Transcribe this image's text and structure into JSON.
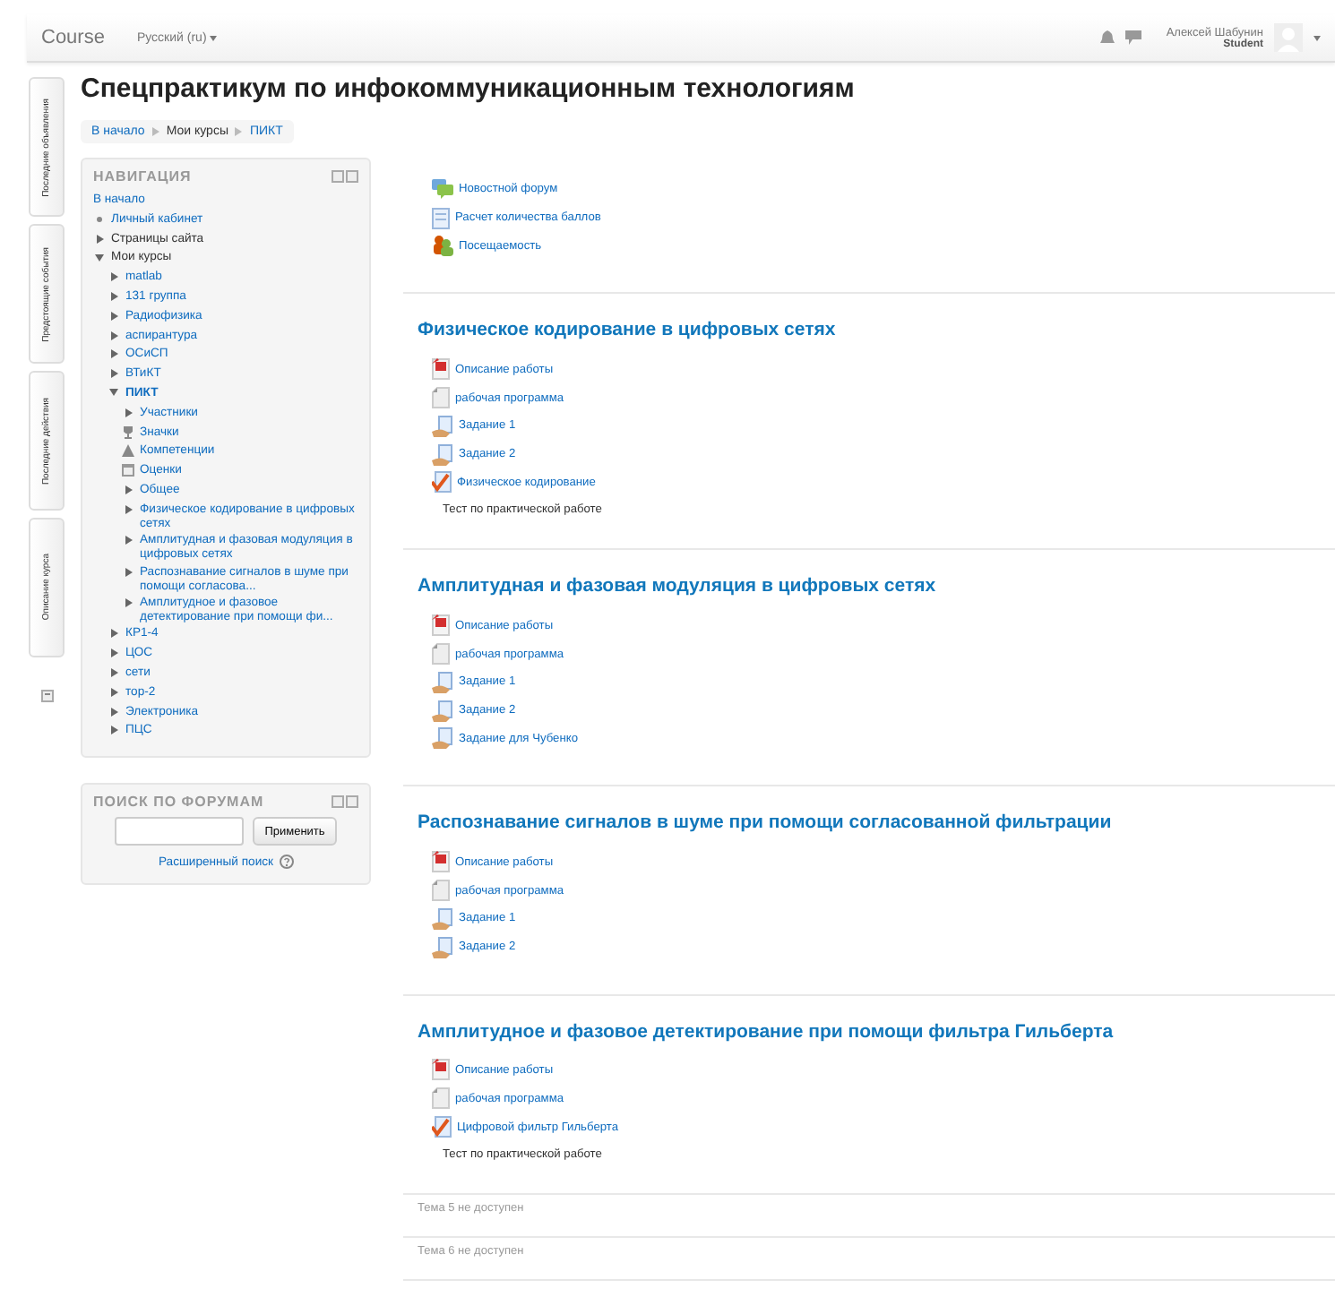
{
  "header": {
    "brand": "Course",
    "language": "Русский (ru)",
    "user_name": "Алексей Шабунин",
    "user_role": "Student"
  },
  "side_tabs": [
    "Последние объявления",
    "Предстоящие события",
    "Последние действия",
    "Описание курса"
  ],
  "page_title": "Спецпрактикум по инфокоммуникационным технологиям",
  "breadcrumb": [
    {
      "label": "В начало",
      "link": true
    },
    {
      "label": "Мои курсы",
      "link": false
    },
    {
      "label": "ПИКТ",
      "link": true
    }
  ],
  "navigation": {
    "title": "НАВИГАЦИЯ",
    "items": [
      {
        "label": "В начало",
        "kind": "plain",
        "link": true,
        "current": false
      },
      {
        "label": "Личный кабинет",
        "kind": "bullet",
        "link": true,
        "current": false
      },
      {
        "label": "Страницы сайта",
        "kind": "collapsed",
        "link": false,
        "current": false
      },
      {
        "label": "Мои курсы",
        "kind": "expanded",
        "link": false,
        "current": false,
        "children": [
          {
            "label": "matlab",
            "kind": "collapsed",
            "link": true,
            "current": false
          },
          {
            "label": "131 группа",
            "kind": "collapsed",
            "link": true,
            "current": false
          },
          {
            "label": "Радиофизика",
            "kind": "collapsed",
            "link": true,
            "current": false
          },
          {
            "label": "аспирантура",
            "kind": "collapsed",
            "link": true,
            "current": false
          },
          {
            "label": "ОСиСП",
            "kind": "collapsed",
            "link": true,
            "current": false
          },
          {
            "label": "ВТиКТ",
            "kind": "collapsed",
            "link": true,
            "current": false
          },
          {
            "label": "ПИКТ",
            "kind": "expanded",
            "link": true,
            "current": true,
            "children": [
              {
                "label": "Участники",
                "kind": "collapsed",
                "link": true,
                "current": false
              },
              {
                "label": "Значки",
                "kind": "trophy",
                "link": true,
                "current": false
              },
              {
                "label": "Компетенции",
                "kind": "competency",
                "link": true,
                "current": false
              },
              {
                "label": "Оценки",
                "kind": "grades",
                "link": true,
                "current": false
              },
              {
                "label": "Общее",
                "kind": "collapsed",
                "link": true,
                "current": false
              },
              {
                "label": "Физическое кодирование в цифровых сетях",
                "kind": "collapsed",
                "link": true,
                "current": false
              },
              {
                "label": "Амплитудная и фазовая модуляция в цифровых сетях",
                "kind": "collapsed",
                "link": true,
                "current": false
              },
              {
                "label": "Распознавание сигналов в шуме при помощи согласова...",
                "kind": "collapsed",
                "link": true,
                "current": false
              },
              {
                "label": "Амплитудное и фазовое детектирование при помощи фи...",
                "kind": "collapsed",
                "link": true,
                "current": false
              }
            ]
          },
          {
            "label": "КР1-4",
            "kind": "collapsed",
            "link": true,
            "current": false
          },
          {
            "label": "ЦОС",
            "kind": "collapsed",
            "link": true,
            "current": false
          },
          {
            "label": "сети",
            "kind": "collapsed",
            "link": true,
            "current": false
          },
          {
            "label": "тор-2",
            "kind": "collapsed",
            "link": true,
            "current": false
          },
          {
            "label": "Электроника",
            "kind": "collapsed",
            "link": true,
            "current": false
          },
          {
            "label": "ПЦС",
            "kind": "collapsed",
            "link": true,
            "current": false
          }
        ]
      }
    ]
  },
  "forum_search": {
    "title": "ПОИСК ПО ФОРУМАМ",
    "button": "Применить",
    "advanced": "Расширенный поиск"
  },
  "sections": [
    {
      "available": true,
      "activities": [
        {
          "kind": "forum",
          "label": "Новостной форум"
        },
        {
          "kind": "sheet",
          "label": "Расчет количества баллов"
        },
        {
          "kind": "attendance",
          "label": "Посещаемость"
        }
      ]
    },
    {
      "title": "Физическое кодирование в цифровых сетях",
      "available": true,
      "activities": [
        {
          "kind": "pdf",
          "label": "Описание работы"
        },
        {
          "kind": "file",
          "label": "рабочая программа"
        },
        {
          "kind": "assign",
          "label": "Задание 1"
        },
        {
          "kind": "assign",
          "label": "Задание 2"
        },
        {
          "kind": "quiz",
          "label": "Физическое кодирование"
        },
        {
          "kind": "text",
          "label": "Тест по практической работе"
        }
      ]
    },
    {
      "title": "Амплитудная и фазовая модуляция в цифровых сетях",
      "available": true,
      "activities": [
        {
          "kind": "pdf",
          "label": "Описание работы"
        },
        {
          "kind": "file",
          "label": "рабочая программа"
        },
        {
          "kind": "assign",
          "label": "Задание 1"
        },
        {
          "kind": "assign",
          "label": "Задание 2"
        },
        {
          "kind": "assign",
          "label": "Задание для Чубенко"
        }
      ]
    },
    {
      "title": "Распознавание сигналов в шуме при помощи согласованной фильтрации",
      "available": true,
      "activities": [
        {
          "kind": "pdf",
          "label": "Описание работы"
        },
        {
          "kind": "file",
          "label": "рабочая программа"
        },
        {
          "kind": "assign",
          "label": "Задание 1"
        },
        {
          "kind": "assign",
          "label": "Задание 2"
        }
      ]
    },
    {
      "title": "Амплитудное и фазовое детектирование при помощи фильтра Гильберта",
      "available": true,
      "activities": [
        {
          "kind": "pdf",
          "label": "Описание работы"
        },
        {
          "kind": "file",
          "label": "рабочая программа"
        },
        {
          "kind": "quiz",
          "label": "Цифровой фильтр Гильберта"
        },
        {
          "kind": "text",
          "label": "Тест по практической работе"
        }
      ]
    },
    {
      "title": "Тема 5 не доступен",
      "available": false
    },
    {
      "title": "Тема 6 не доступен",
      "available": false
    }
  ]
}
